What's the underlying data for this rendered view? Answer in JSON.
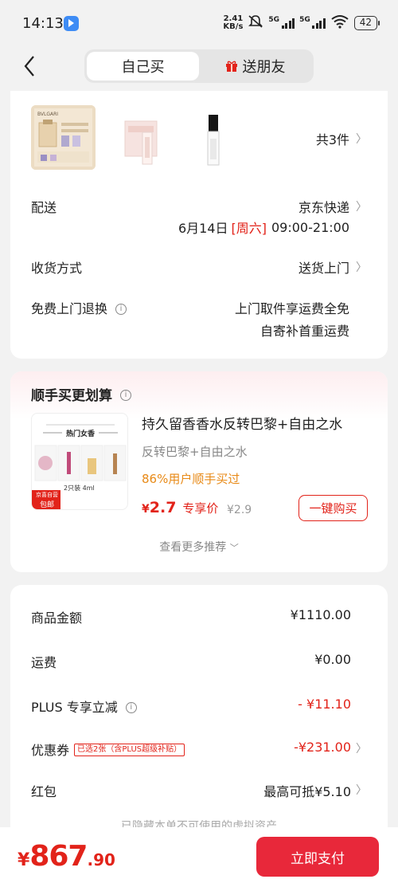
{
  "status_bar": {
    "time": "14:13",
    "speed_value": "2.41",
    "speed_unit": "KB/s",
    "network_1": "5G",
    "network_2": "5G",
    "wifi_sub": "6",
    "battery": "42"
  },
  "header": {
    "tab_self": "自己买",
    "tab_gift": "送朋友",
    "active_tab": "自己买"
  },
  "order": {
    "products_count": "共3件",
    "delivery_label": "配送",
    "delivery_carrier": "京东快递",
    "delivery_date": "6月14日",
    "delivery_weekday": "[周六]",
    "delivery_time": "09:00-21:00",
    "receive_label": "收货方式",
    "receive_value": "送货上门",
    "return_label": "免费上门退换",
    "return_line1": "上门取件享运费全免",
    "return_line2": "自寄补首重运费"
  },
  "upsell": {
    "title": "顺手买更划算",
    "product_name": "持久留香香水反转巴黎+自由之水",
    "product_sub": "反转巴黎+自由之水",
    "buy_rate": "86%用户顺手买过",
    "price_symbol": "¥",
    "price": "2.7",
    "price_tag": "专享价",
    "original_price": "¥2.9",
    "buy_button": "一键购买",
    "more_label": "查看更多推荐",
    "thumb_title": "热门女香",
    "thumb_spec": "2只装 4ml",
    "thumb_badge_1": "京喜自营",
    "thumb_badge_2": "包邮"
  },
  "summary": {
    "items": [
      {
        "label": "商品金额",
        "value": "¥1110.00"
      },
      {
        "label": "运费",
        "value": "¥0.00"
      },
      {
        "label": "PLUS 专享立减",
        "value": "- ¥11.10"
      },
      {
        "label": "优惠券",
        "tag": "已选2张（含PLUS超级补贴）",
        "value": "-¥231.00"
      },
      {
        "label": "红包",
        "value": "最高可抵¥5.10"
      }
    ],
    "hidden_note": "已隐藏本单不可使用的虚拟资产"
  },
  "footer": {
    "currency": "¥",
    "total_int": "867",
    "total_dec": ".90",
    "pay_button": "立即支付"
  },
  "colors": {
    "accent_red": "#e2231a",
    "orange": "#e88a17",
    "background": "#f2f2f2"
  }
}
